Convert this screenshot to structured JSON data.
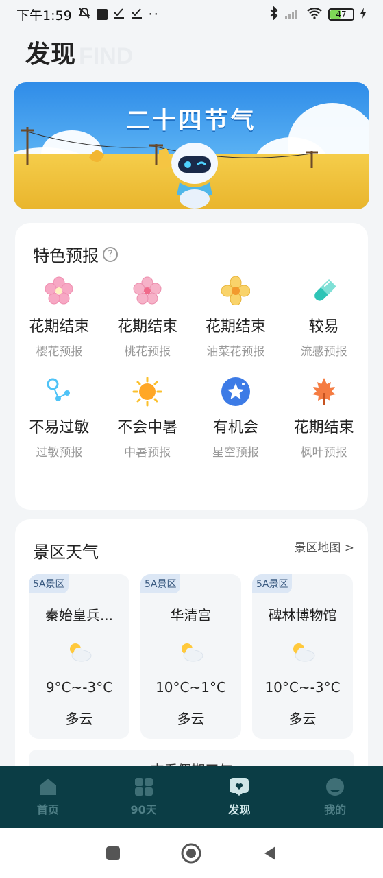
{
  "status_bar": {
    "time": "下午1:59",
    "battery": "47"
  },
  "header": {
    "title": "发现",
    "subtitle": "FIND"
  },
  "banner": {
    "title": "二十四节气"
  },
  "features": {
    "title": "特色预报",
    "help": "?",
    "items": [
      {
        "status": "花期结束",
        "name": "樱花预报",
        "icon": "cherry-blossom-icon",
        "color": "#f48fb1"
      },
      {
        "status": "花期结束",
        "name": "桃花预报",
        "icon": "peach-blossom-icon",
        "color": "#f48fb1"
      },
      {
        "status": "花期结束",
        "name": "油菜花预报",
        "icon": "rapeseed-flower-icon",
        "color": "#f5c542"
      },
      {
        "status": "较易",
        "name": "流感预报",
        "icon": "pill-icon",
        "color": "#2ec4b6"
      },
      {
        "status": "不易过敏",
        "name": "过敏预报",
        "icon": "pollen-icon",
        "color": "#4fc3f7"
      },
      {
        "status": "不会中暑",
        "name": "中暑预报",
        "icon": "sun-icon",
        "color": "#ffa726"
      },
      {
        "status": "有机会",
        "name": "星空预报",
        "icon": "star-icon",
        "color": "#3d7be6"
      },
      {
        "status": "花期结束",
        "name": "枫叶预报",
        "icon": "maple-leaf-icon",
        "color": "#f57c42"
      }
    ]
  },
  "scenic": {
    "title": "景区天气",
    "map_link": "景区地图 >",
    "spots": [
      {
        "badge": "5A景区",
        "name": "秦始皇兵...",
        "temp": "9°C~-3°C",
        "cond": "多云"
      },
      {
        "badge": "5A景区",
        "name": "华清宫",
        "temp": "10°C~1°C",
        "cond": "多云"
      },
      {
        "badge": "5A景区",
        "name": "碑林博物馆",
        "temp": "10°C~-3°C",
        "cond": "多云"
      }
    ],
    "more": "查看假期天气"
  },
  "bottom_nav": [
    {
      "label": "首页",
      "icon": "home-icon"
    },
    {
      "label": "90天",
      "icon": "grid-icon"
    },
    {
      "label": "发现",
      "icon": "discover-icon"
    },
    {
      "label": "我的",
      "icon": "profile-icon"
    }
  ]
}
